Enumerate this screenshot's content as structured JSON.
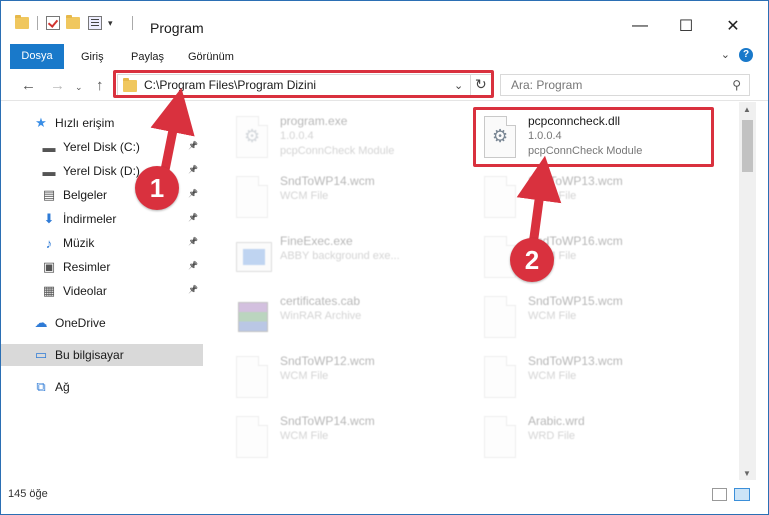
{
  "window": {
    "title": "Program",
    "controls": {
      "minimize": "—",
      "maximize": "☐",
      "close": "✕"
    }
  },
  "ribbon": {
    "tabs": [
      "Dosya",
      "Giriş",
      "Paylaş",
      "Görünüm"
    ],
    "help": "?"
  },
  "address": {
    "path": "C:\\Program Files\\Program Dizini",
    "search_placeholder": "Ara: Program"
  },
  "sidebar": {
    "items": [
      {
        "label": "Hızlı erişim",
        "icon": "star-icon"
      },
      {
        "label": "Yerel Disk (C:)",
        "icon": "drive-icon",
        "pinned": true
      },
      {
        "label": "Yerel Disk (D:)",
        "icon": "drive-icon",
        "pinned": true
      },
      {
        "label": "Belgeler",
        "icon": "documents-icon",
        "pinned": true
      },
      {
        "label": "İndirmeler",
        "icon": "download-icon",
        "pinned": true
      },
      {
        "label": "Müzik",
        "icon": "music-icon",
        "pinned": true
      },
      {
        "label": "Resimler",
        "icon": "pictures-icon",
        "pinned": true
      },
      {
        "label": "Videolar",
        "icon": "videos-icon",
        "pinned": true
      },
      {
        "label": "OneDrive",
        "icon": "cloud-icon"
      },
      {
        "label": "Bu bilgisayar",
        "icon": "computer-icon",
        "selected": true
      },
      {
        "label": "Ağ",
        "icon": "network-icon"
      }
    ]
  },
  "files": [
    {
      "name": "program.exe",
      "line2": "1.0.0.4",
      "line3": "pcpConnCheck Module",
      "icon": "exe-gear-icon"
    },
    {
      "name": "pcpconncheck.dll",
      "line2": "1.0.0.4",
      "line3": "pcpConnCheck Module",
      "icon": "dll-gear-icon"
    },
    {
      "name": "SndToWP14.wcm",
      "line2": "WCM File",
      "line3": "",
      "icon": "file-icon"
    },
    {
      "name": "SndToWP13.wcm",
      "line2": "WCM File",
      "line3": "",
      "icon": "file-icon"
    },
    {
      "name": "FineExec.exe",
      "line2": "ABBY background exe...",
      "line3": "",
      "icon": "app-icon"
    },
    {
      "name": "SndToWP16.wcm",
      "line2": "WCM File",
      "line3": "",
      "icon": "file-icon"
    },
    {
      "name": "certificates.cab",
      "line2": "WinRAR Archive",
      "line3": "",
      "icon": "winrar-icon"
    },
    {
      "name": "SndToWP15.wcm",
      "line2": "WCM File",
      "line3": "",
      "icon": "file-icon"
    },
    {
      "name": "SndToWP12.wcm",
      "line2": "WCM File",
      "line3": "",
      "icon": "file-icon"
    },
    {
      "name": "SndToWP13.wcm",
      "line2": "WCM File",
      "line3": "",
      "icon": "file-icon"
    },
    {
      "name": "SndToWP14.wcm",
      "line2": "WCM File",
      "line3": "",
      "icon": "file-icon"
    },
    {
      "name": "Arabic.wrd",
      "line2": "WRD File",
      "line3": "",
      "icon": "file-icon"
    }
  ],
  "status": {
    "count": "145 öğe"
  },
  "annotations": {
    "badge1": "1",
    "badge2": "2",
    "color": "#d9313e"
  }
}
